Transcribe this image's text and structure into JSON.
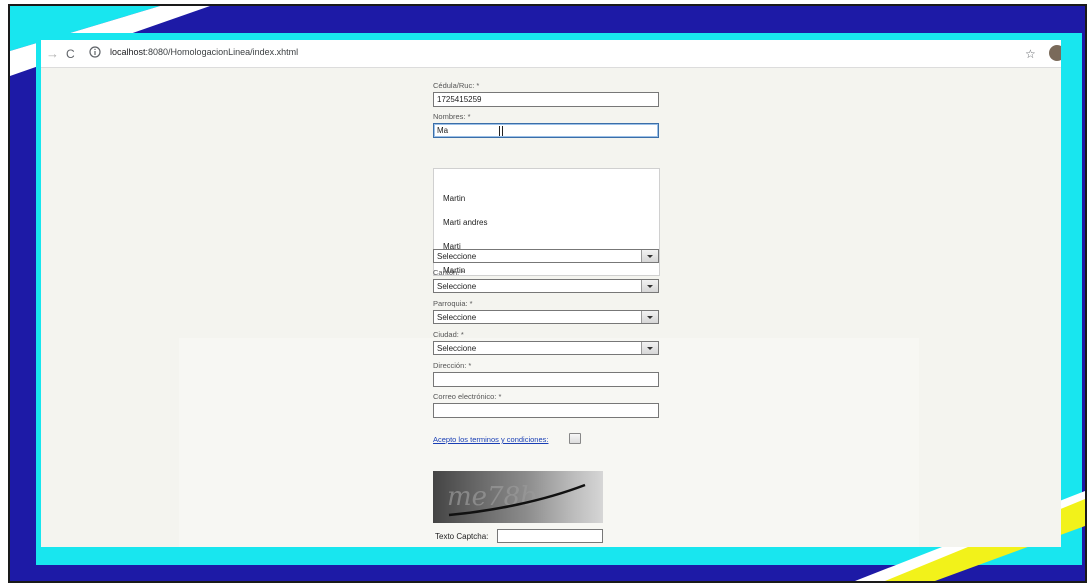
{
  "browser": {
    "url_host": "localhost",
    "url_path": ":8080/HomologacionLinea/index.xhtml"
  },
  "form": {
    "cedula_label": "Cédula/Ruc: *",
    "cedula_value": "1725415259",
    "nombres_label": "Nombres: *",
    "nombres_value": "Ma",
    "autocomplete": [
      "Martin",
      "Marti andres",
      "Marti",
      "Martin"
    ],
    "provincia_value": "Seleccione",
    "canton_label": "Cantón: *",
    "canton_value": "Seleccione",
    "parroquia_label": "Parroquia: *",
    "parroquia_value": "Seleccione",
    "ciudad_label": "Ciudad: *",
    "ciudad_value": "Seleccione",
    "direccion_label": "Dirección: *",
    "direccion_value": "",
    "correo_label": "Correo electrónico: *",
    "correo_value": "",
    "terms_link": "Acepto los terminos y condiciones:",
    "terms_checked": false,
    "captcha_text": "me78b",
    "captcha_label": "Texto Captcha:",
    "captcha_value": ""
  },
  "colors": {
    "frame_blue": "#1d1aa6",
    "frame_cyan": "#18e6ef",
    "frame_yellow": "#f2f21a",
    "link_blue": "#1a3fb5"
  },
  "icons": [
    "back-arrow-icon",
    "reload-icon",
    "info-icon",
    "star-icon",
    "avatar"
  ]
}
